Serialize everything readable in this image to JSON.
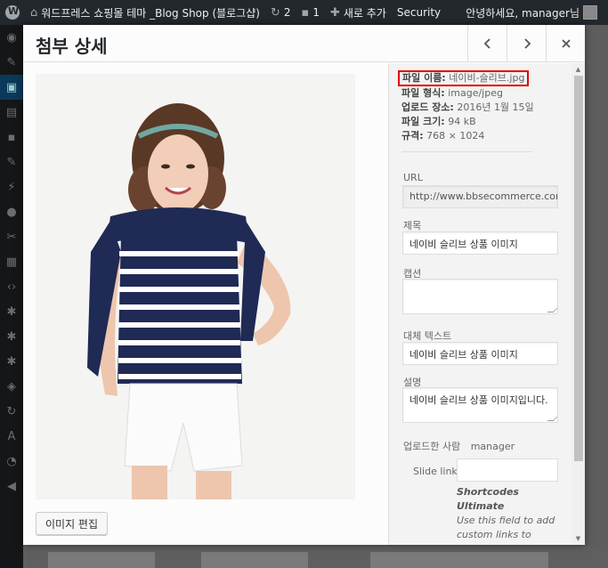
{
  "admin_bar": {
    "site_name": "워드프레스 쇼핑몰 테마 _Blog Shop (블로그샵)",
    "updates_count": "2",
    "comments_count": "1",
    "new_label": "새로 추가",
    "security_label": "Security",
    "greeting": "안녕하세요, manager님"
  },
  "modal": {
    "title": "첨부 상세",
    "edit_image_label": "이미지 편집"
  },
  "details": {
    "file_name_label": "파일 이름:",
    "file_name": "네이비-슬리브.jpg",
    "file_type_label": "파일 형식:",
    "file_type": "image/jpeg",
    "uploaded_label": "업로드 장소:",
    "uploaded": "2016년 1월 15일",
    "file_size_label": "파일 크기:",
    "file_size": "94 kB",
    "dimensions_label": "규격:",
    "dimensions": "768 × 1024"
  },
  "fields": {
    "url_label": "URL",
    "url_value": "http://www.bbsecommerce.com/w",
    "title_label": "제목",
    "title_value": "네이비 슬리브 상품 이미지",
    "caption_label": "캡션",
    "caption_value": "",
    "alt_label": "대체 텍스트",
    "alt_value": "네이비 슬리브 상품 이미지",
    "description_label": "설명",
    "description_value": "네이비 슬리브 상품 이미지입니다.",
    "uploaded_by_label": "업로드한 사람",
    "uploaded_by_value": "manager",
    "slide_link_label": "Slide link",
    "slide_link_value": "",
    "slide_help_title": "Shortcodes Ultimate",
    "slide_help_text": "Use this field to add custom links to slides used with Slider, Carousel and Custom..."
  },
  "colors": {
    "admin_bar": "#23282d",
    "highlight_border": "#e00000",
    "panel_bg": "#f3f3f3"
  }
}
